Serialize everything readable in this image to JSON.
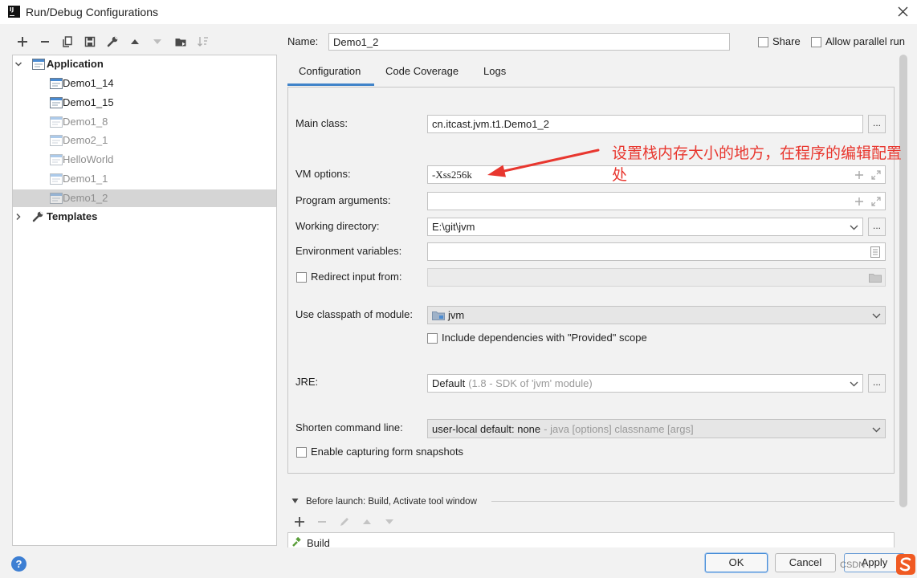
{
  "window": {
    "title": "Run/Debug Configurations",
    "app_icon": "intellij-icon",
    "app_icon_letters": "IJ",
    "close_icon": "close-icon"
  },
  "colors": {
    "background": "#f2f2f2",
    "accent": "#4083c9",
    "selection": "#d5d5d5",
    "annotation": "#e8372f",
    "help": "#3d7fd3"
  },
  "left_toolbar": {
    "icons": [
      "add-icon",
      "remove-icon",
      "copy-icon",
      "save-icon",
      "wrench-icon",
      "move-up-icon",
      "move-down-icon",
      "move-to-folder-icon",
      "sort-icon"
    ]
  },
  "tree": {
    "application": {
      "label": "Application",
      "icon": "application-icon",
      "expanded": true,
      "children": [
        {
          "label": "Demo1_14",
          "temporary": false,
          "selected": false
        },
        {
          "label": "Demo1_15",
          "temporary": false,
          "selected": false
        },
        {
          "label": "Demo1_8",
          "temporary": true,
          "selected": false
        },
        {
          "label": "Demo2_1",
          "temporary": true,
          "selected": false
        },
        {
          "label": "HelloWorld",
          "temporary": true,
          "selected": false
        },
        {
          "label": "Demo1_1",
          "temporary": true,
          "selected": false
        },
        {
          "label": "Demo1_2",
          "temporary": true,
          "selected": true
        }
      ]
    },
    "templates": {
      "label": "Templates",
      "icon": "wrench-icon",
      "expanded": false
    }
  },
  "name_field": {
    "label": "Name:",
    "value": "Demo1_2"
  },
  "options": {
    "share": {
      "label": "Share",
      "checked": false
    },
    "allow_parallel_run": {
      "label": "Allow parallel run",
      "checked": false
    }
  },
  "tabs": [
    {
      "label": "Configuration",
      "selected": true
    },
    {
      "label": "Code Coverage",
      "selected": false
    },
    {
      "label": "Logs",
      "selected": false
    }
  ],
  "form": {
    "main_class": {
      "label": "Main class:",
      "value": "cn.itcast.jvm.t1.Demo1_2",
      "browse": "..."
    },
    "vm_options": {
      "label": "VM options:",
      "value": "-Xss256k"
    },
    "program_arguments": {
      "label": "Program arguments:",
      "value": ""
    },
    "working_directory": {
      "label": "Working directory:",
      "value": "E:\\git\\jvm",
      "browse": "..."
    },
    "environment_variables": {
      "label": "Environment variables:",
      "value": ""
    },
    "redirect_input": {
      "label": "Redirect input from:",
      "checked": false,
      "value": ""
    },
    "classpath_module": {
      "label": "Use classpath of module:",
      "value": "jvm",
      "icon": "module-folder-icon"
    },
    "include_provided": {
      "label": "Include dependencies with \"Provided\" scope",
      "checked": false
    },
    "jre": {
      "label": "JRE:",
      "value": "Default",
      "hint": "(1.8 - SDK of 'jvm' module)",
      "browse": "..."
    },
    "shorten_command_line": {
      "label": "Shorten command line:",
      "value": "user-local default: none",
      "hint": "- java [options] classname [args]"
    },
    "form_snapshots": {
      "label": "Enable capturing form snapshots",
      "checked": false
    }
  },
  "before_launch": {
    "label": "Before launch: Build, Activate tool window",
    "expanded": true,
    "toolbar_icons": [
      "add-icon",
      "remove-icon",
      "edit-icon",
      "move-up-icon",
      "move-down-icon"
    ],
    "tasks": [
      {
        "label": "Build",
        "icon": "build-icon"
      }
    ]
  },
  "buttons": {
    "ok": "OK",
    "cancel": "Cancel",
    "apply": "Apply",
    "help_icon": "help-icon"
  },
  "annotation": {
    "text": "设置栈内存大小的地方，在程序的编辑配置处"
  },
  "watermark": {
    "text": "CSDN"
  }
}
